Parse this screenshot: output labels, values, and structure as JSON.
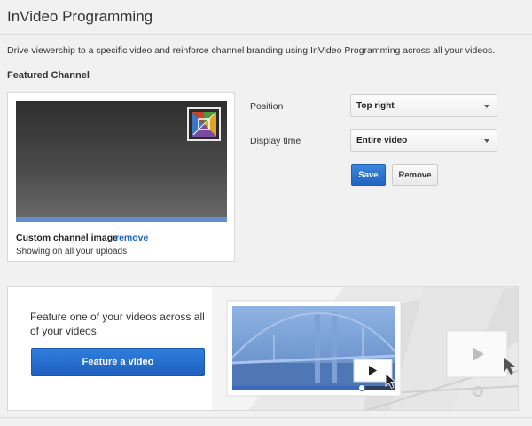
{
  "page": {
    "title": "InVideo Programming",
    "description": "Drive viewership to a specific video and reinforce channel branding using InVideo Programming across all your videos."
  },
  "featured_channel": {
    "heading": "Featured Channel",
    "image_label": "Custom channel image",
    "remove_link": "remove",
    "uploads_note": "Showing on all your uploads"
  },
  "settings": {
    "position_label": "Position",
    "position_value": "Top right",
    "display_time_label": "Display time",
    "display_time_value": "Entire video",
    "save_label": "Save",
    "remove_label": "Remove"
  },
  "feature_video": {
    "promo_text": "Feature one of your videos across all of your videos.",
    "button_label": "Feature a video"
  },
  "colors": {
    "accent_blue": "#2a6fcf",
    "link_blue": "#1c62b9",
    "progress_blue": "#5f8fd1"
  },
  "icons": [
    "channel-logo-icon",
    "dropdown-caret-icon",
    "play-icon",
    "mouse-cursor-icon"
  ]
}
